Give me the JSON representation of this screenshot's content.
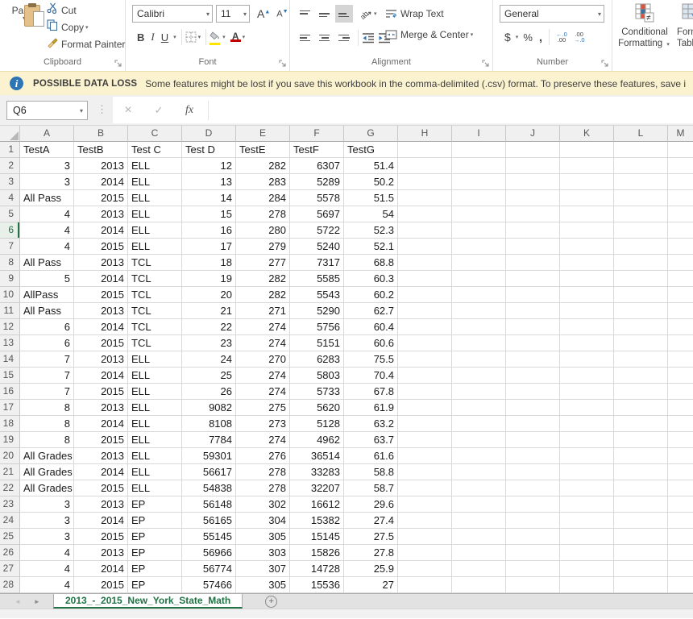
{
  "colors": {
    "accent_green": "#217346",
    "info_blue": "#2E75B6",
    "warning_bg": "#FBF3CF",
    "fill_yellow": "#FFE400",
    "font_red": "#C00000"
  },
  "ribbon": {
    "clipboard": {
      "label": "Clipboard",
      "paste": "Paste",
      "cut": "Cut",
      "copy": "Copy",
      "format_painter": "Format Painter"
    },
    "font": {
      "label": "Font",
      "font_name": "Calibri",
      "font_size": "11",
      "bold": "B",
      "italic": "I",
      "underline": "U",
      "grow": "A",
      "shrink": "A"
    },
    "alignment": {
      "label": "Alignment",
      "wrap_text": "Wrap Text",
      "merge_center": "Merge & Center",
      "orientation": "ab"
    },
    "number": {
      "label": "Number",
      "format": "General",
      "currency": "$",
      "percent": "%",
      "comma": ",",
      "inc_decimal_top": "←.0",
      "inc_decimal_bot": ".00",
      "dec_decimal_top": ".00",
      "dec_decimal_bot": "→.0"
    },
    "styles": {
      "conditional_line1": "Conditional",
      "conditional_line2": "Formatting",
      "neq": "≠",
      "table_line1": "Forma",
      "table_line2": "Tabl"
    }
  },
  "warning": {
    "title": "POSSIBLE DATA LOSS",
    "message": "Some features might be lost if you save this workbook in the comma-delimited (.csv) format. To preserve these features, save i"
  },
  "formula_bar": {
    "name_box": "Q6",
    "formula": ""
  },
  "grid": {
    "selected_row": 6,
    "columns": [
      "A",
      "B",
      "C",
      "D",
      "E",
      "F",
      "G",
      "H",
      "I",
      "J",
      "K",
      "L",
      "M"
    ],
    "rows": [
      [
        "TestA",
        "TestB",
        "Test C",
        "Test D",
        "TestE",
        "TestF",
        "TestG"
      ],
      [
        "3",
        "2013",
        "ELL",
        "12",
        "282",
        "6307",
        "51.4"
      ],
      [
        "3",
        "2014",
        "ELL",
        "13",
        "283",
        "5289",
        "50.2"
      ],
      [
        "All Pass",
        "2015",
        "ELL",
        "14",
        "284",
        "5578",
        "51.5"
      ],
      [
        "4",
        "2013",
        "ELL",
        "15",
        "278",
        "5697",
        "54"
      ],
      [
        "4",
        "2014",
        "ELL",
        "16",
        "280",
        "5722",
        "52.3"
      ],
      [
        "4",
        "2015",
        "ELL",
        "17",
        "279",
        "5240",
        "52.1"
      ],
      [
        "All Pass",
        "2013",
        "TCL",
        "18",
        "277",
        "7317",
        "68.8"
      ],
      [
        "5",
        "2014",
        "TCL",
        "19",
        "282",
        "5585",
        "60.3"
      ],
      [
        "AllPass",
        "2015",
        "TCL",
        "20",
        "282",
        "5543",
        "60.2"
      ],
      [
        "All Pass",
        "2013",
        "TCL",
        "21",
        "271",
        "5290",
        "62.7"
      ],
      [
        "6",
        "2014",
        "TCL",
        "22",
        "274",
        "5756",
        "60.4"
      ],
      [
        "6",
        "2015",
        "TCL",
        "23",
        "274",
        "5151",
        "60.6"
      ],
      [
        "7",
        "2013",
        "ELL",
        "24",
        "270",
        "6283",
        "75.5"
      ],
      [
        "7",
        "2014",
        "ELL",
        "25",
        "274",
        "5803",
        "70.4"
      ],
      [
        "7",
        "2015",
        "ELL",
        "26",
        "274",
        "5733",
        "67.8"
      ],
      [
        "8",
        "2013",
        "ELL",
        "9082",
        "275",
        "5620",
        "61.9"
      ],
      [
        "8",
        "2014",
        "ELL",
        "8108",
        "273",
        "5128",
        "63.2"
      ],
      [
        "8",
        "2015",
        "ELL",
        "7784",
        "274",
        "4962",
        "63.7"
      ],
      [
        "All Grades",
        "2013",
        "ELL",
        "59301",
        "276",
        "36514",
        "61.6"
      ],
      [
        "All Grades",
        "2014",
        "ELL",
        "56617",
        "278",
        "33283",
        "58.8"
      ],
      [
        "All Grades",
        "2015",
        "ELL",
        "54838",
        "278",
        "32207",
        "58.7"
      ],
      [
        "3",
        "2013",
        "EP",
        "56148",
        "302",
        "16612",
        "29.6"
      ],
      [
        "3",
        "2014",
        "EP",
        "56165",
        "304",
        "15382",
        "27.4"
      ],
      [
        "3",
        "2015",
        "EP",
        "55145",
        "305",
        "15145",
        "27.5"
      ],
      [
        "4",
        "2013",
        "EP",
        "56966",
        "303",
        "15826",
        "27.8"
      ],
      [
        "4",
        "2014",
        "EP",
        "56774",
        "307",
        "14728",
        "25.9"
      ],
      [
        "4",
        "2015",
        "EP",
        "57466",
        "305",
        "15536",
        "27"
      ]
    ]
  },
  "sheet_tabs": {
    "active": "2013_-_2015_New_York_State_Math"
  },
  "icons": {
    "dropdown": "▾",
    "dots": "⋮",
    "cancel": "×",
    "enter": "✓",
    "fx": "fx",
    "nav_left": "◄",
    "nav_right": "►",
    "plus": "+"
  }
}
